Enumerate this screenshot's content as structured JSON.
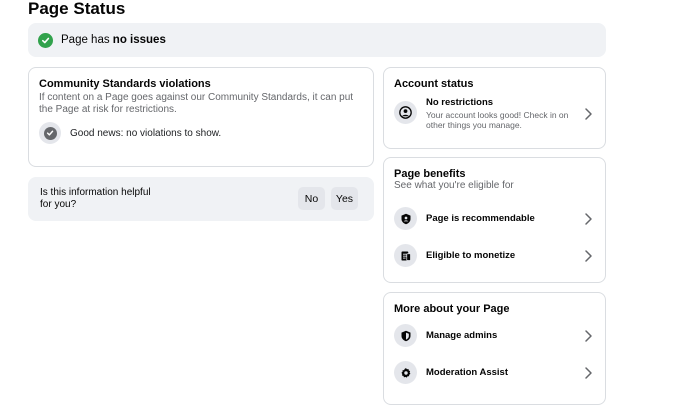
{
  "page_title": "Page Status",
  "status": {
    "prefix": "Page has ",
    "emphasis": "no issues",
    "color": "#31a24c"
  },
  "community_standards": {
    "title": "Community Standards violations",
    "description": "If content on a Page goes against our Community Standards, it can put the Page at risk for restrictions.",
    "good_news": "Good news: no violations to show."
  },
  "feedback": {
    "question": "Is this information helpful for you?",
    "no_label": "No",
    "yes_label": "Yes"
  },
  "account_status": {
    "title": "Account status",
    "item_title": "No restrictions",
    "item_desc": "Your account looks good! Check in on other things you manage."
  },
  "page_benefits": {
    "title": "Page benefits",
    "subtitle": "See what you're eligible for",
    "items": [
      {
        "label": "Page is recommendable",
        "icon": "shield-person-icon"
      },
      {
        "label": "Eligible to monetize",
        "icon": "monetize-icon"
      }
    ]
  },
  "more_about": {
    "title": "More about your Page",
    "items": [
      {
        "label": "Manage admins",
        "icon": "shield-icon"
      },
      {
        "label": "Moderation Assist",
        "icon": "gear-icon"
      }
    ]
  }
}
